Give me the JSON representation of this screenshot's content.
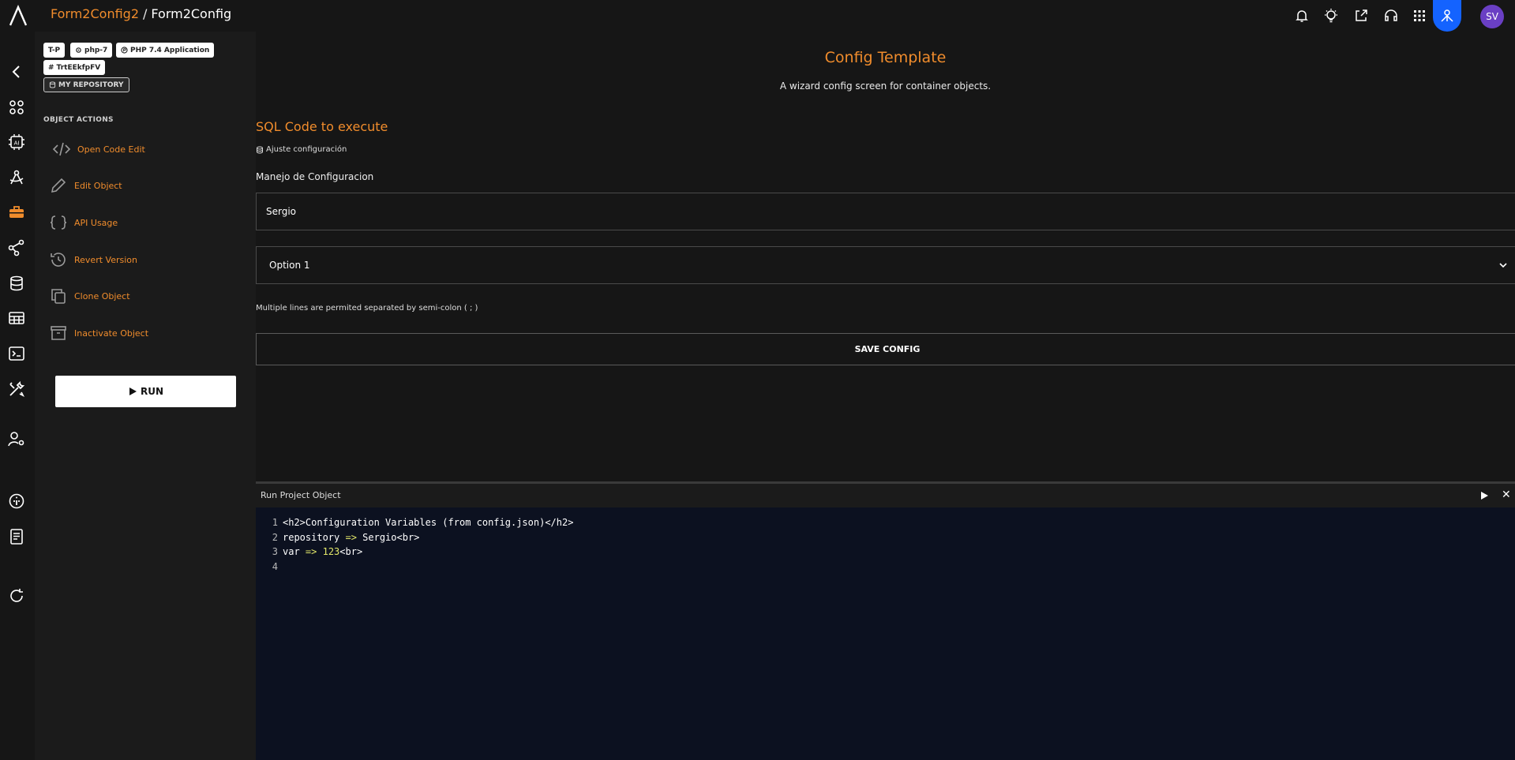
{
  "topbar": {
    "breadcrumb_project": "Form2Config2",
    "breadcrumb_separator": "/",
    "breadcrumb_object": "Form2Config",
    "icons": [
      "bell-icon",
      "lightbulb-icon",
      "share-icon",
      "headset-icon",
      "apps-grid-icon",
      "user-network-icon"
    ],
    "avatar_initials": "SV",
    "accent_color": "#1463ff",
    "avatar_color": "#6a3fc4"
  },
  "rail": {
    "icons": [
      "back-arrow-icon",
      "dashboard-icon",
      "ai-chip-icon",
      "compass-icon",
      "toolbox-icon",
      "flow-icon",
      "database-icon",
      "table-icon",
      "terminal-icon",
      "tools-icon",
      "user-settings-icon",
      "info-icon",
      "book-icon",
      "refresh-icon"
    ]
  },
  "sidebar": {
    "chips": {
      "tp": "T-P",
      "php": "php-7",
      "app": "PHP 7.4 Application",
      "hash": "TrtEEkfpFV",
      "repo": "MY REPOSITORY"
    },
    "object_actions_heading": "OBJECT ACTIONS",
    "actions": [
      {
        "label": "Open Code Edit",
        "icon": "code-icon"
      },
      {
        "label": "Edit Object",
        "icon": "pencil-icon"
      },
      {
        "label": "API Usage",
        "icon": "braces-icon"
      },
      {
        "label": "Revert Version",
        "icon": "history-icon"
      },
      {
        "label": "Clone Object",
        "icon": "copy-icon"
      },
      {
        "label": "Inactivate Object",
        "icon": "archive-icon"
      }
    ],
    "run_label": "RUN"
  },
  "main": {
    "title": "Config Template",
    "subtitle": "A wizard config screen for container objects.",
    "section_title": "SQL Code to execute",
    "setting_label": "Ajuste configuración",
    "field_label": "Manejo de Configuracion",
    "input_value": "Sergio",
    "select_value": "Option 1",
    "helper_text": "Multiple lines are permited separated by semi-colon ( ; )",
    "save_label": "SAVE CONFIG",
    "accent_color": "#f08c2c"
  },
  "panel": {
    "title": "Run Project Object",
    "lines": [
      {
        "n": "1",
        "parts": [
          "<h2>Configuration Variables (from config.json)</h2>"
        ]
      },
      {
        "n": "2",
        "parts": [
          "repository ",
          "=>",
          " Sergio<br>"
        ]
      },
      {
        "n": "3",
        "parts": [
          "var ",
          "=>",
          " ",
          "123",
          "<br>"
        ]
      },
      {
        "n": "4",
        "parts": [
          ""
        ]
      }
    ]
  }
}
